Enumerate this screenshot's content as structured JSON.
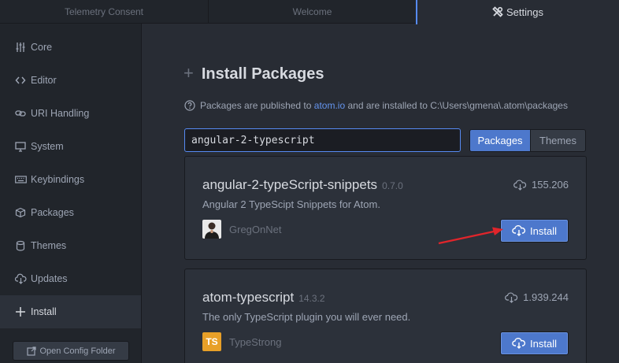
{
  "tabs": [
    {
      "label": "Telemetry Consent"
    },
    {
      "label": "Welcome"
    },
    {
      "label": "Settings",
      "icon": "tools-icon"
    }
  ],
  "sidebar": {
    "items": [
      {
        "label": "Core",
        "icon": "sliders-icon"
      },
      {
        "label": "Editor",
        "icon": "code-icon"
      },
      {
        "label": "URI Handling",
        "icon": "link-icon"
      },
      {
        "label": "System",
        "icon": "monitor-icon"
      },
      {
        "label": "Keybindings",
        "icon": "keyboard-icon"
      },
      {
        "label": "Packages",
        "icon": "package-icon"
      },
      {
        "label": "Themes",
        "icon": "paintcan-icon"
      },
      {
        "label": "Updates",
        "icon": "cloud-download-icon"
      },
      {
        "label": "Install",
        "icon": "plus-icon",
        "active": true
      }
    ],
    "config_button": "Open Config Folder"
  },
  "main": {
    "title": "Install Packages",
    "info": {
      "prefix": "Packages are published to",
      "link": "atom.io",
      "suffix": "and are installed to C:\\Users\\gmena\\.atom\\packages"
    },
    "search": {
      "value": "angular-2-typescript"
    },
    "toggle": {
      "packages": "Packages",
      "themes": "Themes",
      "selected": "Packages"
    },
    "results": [
      {
        "name": "angular-2-typeScript-snippets",
        "version": "0.7.0",
        "downloads": "155.206",
        "description": "Angular 2 TypeScipt Snippets for Atom.",
        "author": "GregOnNet",
        "install_label": "Install"
      },
      {
        "name": "atom-typescript",
        "version": "14.3.2",
        "downloads": "1.939.244",
        "description": "The only TypeScript plugin you will ever need.",
        "author": "TypeStrong",
        "author_avatar_text": "TS",
        "install_label": "Install"
      }
    ]
  },
  "colors": {
    "accent": "#568af2",
    "button": "#4d78cc",
    "annotation_arrow": "#e0252b",
    "ts_badge": "#e8a028"
  }
}
